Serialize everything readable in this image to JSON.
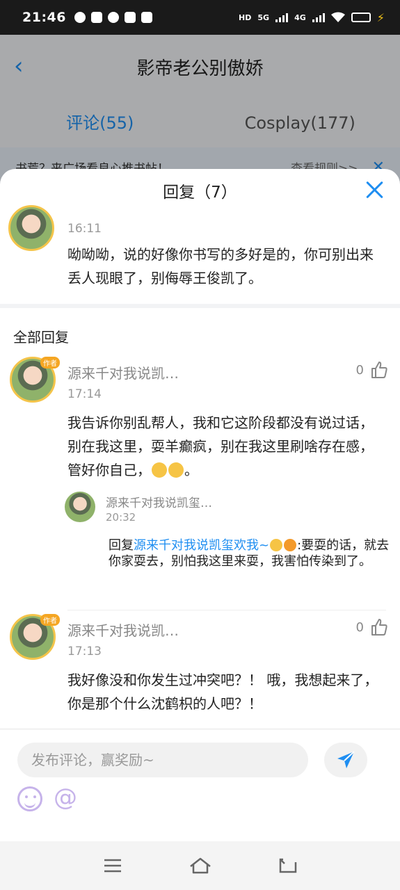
{
  "status_bar": {
    "time": "21:46",
    "network_1": "5G",
    "network_2": "4G",
    "hd_label": "HD"
  },
  "background_page": {
    "title": "影帝老公别傲娇",
    "tabs": [
      {
        "label": "评论(55)",
        "active": true
      },
      {
        "label": "Cosplay(177)",
        "active": false
      }
    ],
    "notice": {
      "text": "书荒？来广场看良心推书帖！",
      "rule_link": "查看规则>>"
    }
  },
  "sheet": {
    "title": "回复（7）",
    "parent_comment": {
      "time": "16:11",
      "text": "呦呦呦，说的好像你书写的多好是的，你可别出来丢人现眼了，别侮辱王俊凯了。"
    },
    "section_label": "全部回复",
    "replies": [
      {
        "badge": "作者",
        "name": "源来千对我说凯…",
        "time": "17:14",
        "likes": "0",
        "text": "我告诉你别乱帮人，我和它这阶段都没有说过话，别在我这里，耍羊癫疯，别在我这里刷啥存在感，管好你自己，",
        "text_suffix": "。",
        "subreply": {
          "name": "源来千对我说凯玺…",
          "time": "20:32",
          "prefix": "回复",
          "mention": "源来千对我说凯玺欢我~",
          "text": ":要耍的话，就去你家耍去，别怕我这里来耍，我害怕传染到了。"
        }
      },
      {
        "badge": "作者",
        "name": "源来千对我说凯…",
        "time": "17:13",
        "likes": "0",
        "text": "我好像没和你发生过冲突吧？！ 哦，我想起来了，你是那个什么沈鹤枳的人吧？！"
      }
    ]
  },
  "input_bar": {
    "placeholder": "发布评论，赢奖励~",
    "at_symbol": "@"
  },
  "colors": {
    "accent": "#1f8ef1",
    "avatar_ring": "#f4c44a",
    "icon_purple": "#c6b3ea"
  }
}
